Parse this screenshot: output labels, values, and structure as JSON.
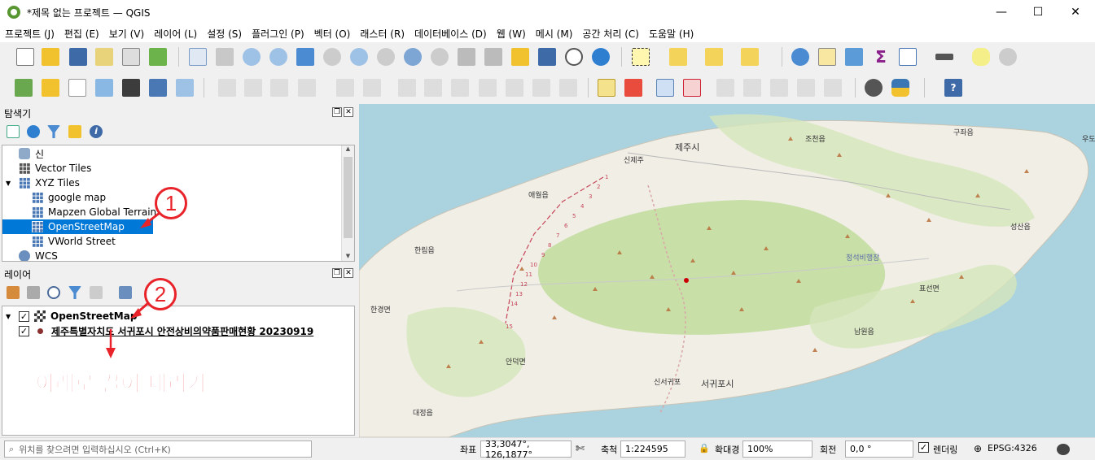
{
  "window": {
    "title": "*제목 없는 프로젝트 — QGIS",
    "minimize": "—",
    "maximize": "☐",
    "close": "✕"
  },
  "menu": [
    "프로젝트 (J)",
    "편집 (E)",
    "보기 (V)",
    "레이어 (L)",
    "설정 (S)",
    "플러그인 (P)",
    "벡터 (O)",
    "래스터 (R)",
    "데이터베이스 (D)",
    "웹 (W)",
    "메시 (M)",
    "공간 처리 (C)",
    "도움말 (H)"
  ],
  "browser": {
    "title": "탐색기",
    "items": [
      {
        "label": "신",
        "indent": 0
      },
      {
        "label": "Vector Tiles",
        "indent": 0
      },
      {
        "label": "XYZ Tiles",
        "indent": 0,
        "expanded": true
      },
      {
        "label": "google map",
        "indent": 1
      },
      {
        "label": "Mapzen Global Terrain",
        "indent": 1
      },
      {
        "label": "OpenStreetMap",
        "indent": 1,
        "selected": true
      },
      {
        "label": "VWorld Street",
        "indent": 1
      },
      {
        "label": "WCS",
        "indent": 0
      }
    ]
  },
  "layers": {
    "title": "레이어",
    "items": [
      {
        "label": "OpenStreetMap",
        "checked": true
      },
      {
        "label": "제주특별자치도 서귀포시 안전상비의약품판매현황 20230919",
        "checked": true
      }
    ]
  },
  "annotations": {
    "one": "1",
    "two": "2",
    "drag_text": "아래로 끌어 내리기",
    "color": "#e8232a"
  },
  "map": {
    "labels": [
      "제주시",
      "신제주",
      "조천읍",
      "구좌읍",
      "애월읍",
      "한림읍",
      "한경면",
      "대정읍",
      "안덕면",
      "서귀포시",
      "신서귀포",
      "남원읍",
      "표선면",
      "성산읍",
      "정석비행장",
      "우도"
    ],
    "road_numbers": [
      "1",
      "2",
      "3",
      "4",
      "5",
      "6",
      "7",
      "8",
      "9",
      "10",
      "11",
      "12",
      "13",
      "14",
      "15"
    ]
  },
  "status": {
    "search_placeholder": "위치를 찾으려면 입력하십시오 (Ctrl+K)",
    "coord_label": "좌표",
    "coord_value": "33,3047°, 126,1877°",
    "scale_label": "축척",
    "scale_value": "1:224595",
    "mag_label": "확대경",
    "mag_value": "100%",
    "rot_label": "회전",
    "rot_value": "0,0 °",
    "render_label": "렌더링",
    "crs": "EPSG:4326"
  }
}
